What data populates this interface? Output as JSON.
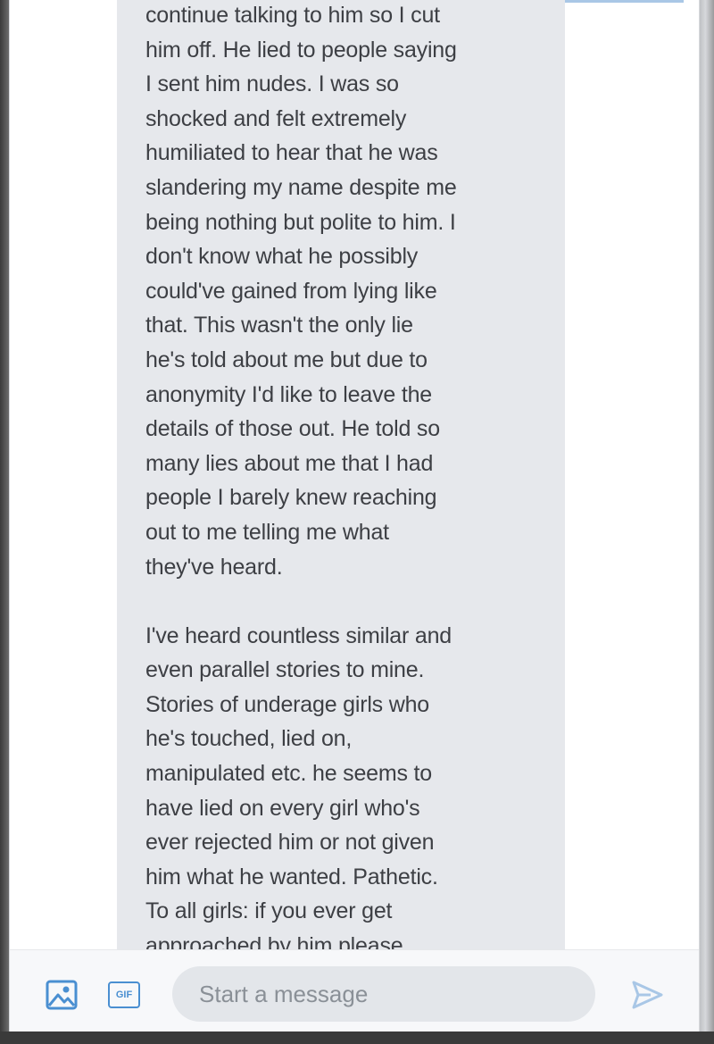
{
  "thread": {
    "message_text": "continue talking to him so I cut\nhim off. He lied to people saying\nI sent him nudes. I was so\nshocked and felt extremely\nhumiliated to hear that he was\nslandering my name despite me\nbeing nothing but polite to him. I\ndon't know what he possibly\ncould've gained from lying like\nthat. This wasn't the only lie\nhe's told about me but due to\nanonymity I'd like to leave the\ndetails of those out. He told so\nmany lies about me that I had\npeople I barely knew reaching\nout to me telling me what\nthey've heard.\n\nI've heard countless similar and\neven parallel stories to mine.\nStories of underage girls who\nhe's touched, lied on,\nmanipulated etc. he seems to\nhave lied on every girl who's\never rejected him or not given\nhim what he wanted. Pathetic.\nTo all girls: if you ever get\napproached by him please"
  },
  "composer": {
    "placeholder": "Start a message",
    "value": "",
    "gif_label": "GIF",
    "icons": {
      "image": "image-icon",
      "gif": "gif-icon",
      "send": "send-icon"
    }
  },
  "colors": {
    "accent": "#4a8fd1",
    "bubble": "#e6e8ec",
    "input_bg": "#e3e6ea"
  }
}
